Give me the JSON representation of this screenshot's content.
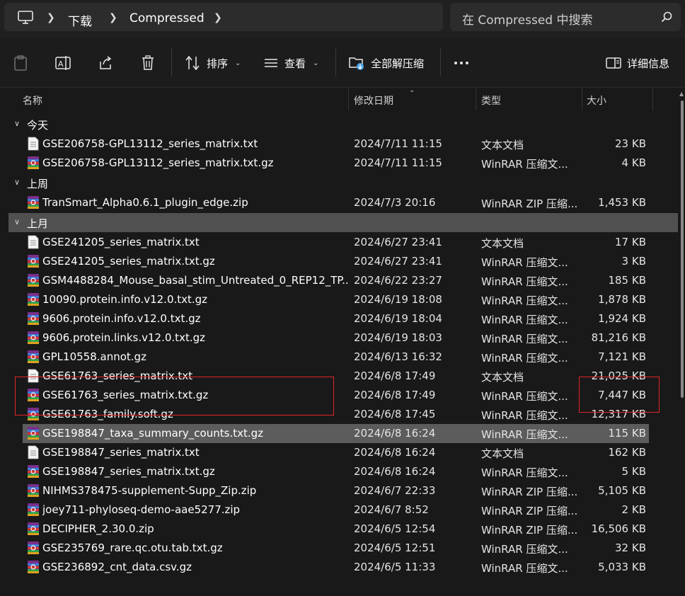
{
  "address_bar": {
    "breadcrumbs": [
      "下载",
      "Compressed"
    ],
    "search_placeholder": "在 Compressed 中搜索"
  },
  "toolbar": {
    "sort_label": "排序",
    "view_label": "查看",
    "extract_label": "全部解压缩",
    "details_label": "详细信息"
  },
  "columns": {
    "name": "名称",
    "date": "修改日期",
    "type": "类型",
    "size": "大小"
  },
  "groups": [
    {
      "label": "今天",
      "files": [
        {
          "name": "GSE206758-GPL13112_series_matrix.txt",
          "date": "2024/7/11 11:15",
          "type": "文本文档",
          "size": "23 KB",
          "icon": "text-file-icon"
        },
        {
          "name": "GSE206758-GPL13112_series_matrix.txt.gz",
          "date": "2024/7/11 11:15",
          "type": "WinRAR 压缩文...",
          "size": "4 KB",
          "icon": "winrar-archive-icon"
        }
      ]
    },
    {
      "label": "上周",
      "files": [
        {
          "name": "TranSmart_Alpha0.6.1_plugin_edge.zip",
          "date": "2024/7/3 20:16",
          "type": "WinRAR ZIP 压缩...",
          "size": "1,453 KB",
          "icon": "winrar-archive-icon"
        }
      ]
    },
    {
      "label": "上月",
      "files": [
        {
          "name": "GSE241205_series_matrix.txt",
          "date": "2024/6/27 23:41",
          "type": "文本文档",
          "size": "17 KB",
          "icon": "text-file-icon"
        },
        {
          "name": "GSE241205_series_matrix.txt.gz",
          "date": "2024/6/27 23:41",
          "type": "WinRAR 压缩文...",
          "size": "3 KB",
          "icon": "winrar-archive-icon"
        },
        {
          "name": "GSM4488284_Mouse_basal_stim_Untreated_0_REP12_TP...",
          "date": "2024/6/22 23:27",
          "type": "WinRAR 压缩文...",
          "size": "185 KB",
          "icon": "winrar-archive-icon"
        },
        {
          "name": "10090.protein.info.v12.0.txt.gz",
          "date": "2024/6/19 18:08",
          "type": "WinRAR 压缩文...",
          "size": "1,878 KB",
          "icon": "winrar-archive-icon"
        },
        {
          "name": "9606.protein.info.v12.0.txt.gz",
          "date": "2024/6/19 18:04",
          "type": "WinRAR 压缩文...",
          "size": "1,924 KB",
          "icon": "winrar-archive-icon"
        },
        {
          "name": "9606.protein.links.v12.0.txt.gz",
          "date": "2024/6/19 18:03",
          "type": "WinRAR 压缩文...",
          "size": "81,216 KB",
          "icon": "winrar-archive-icon"
        },
        {
          "name": "GPL10558.annot.gz",
          "date": "2024/6/13 16:32",
          "type": "WinRAR 压缩文...",
          "size": "7,121 KB",
          "icon": "winrar-archive-icon"
        },
        {
          "name": "GSE61763_series_matrix.txt",
          "date": "2024/6/8 17:49",
          "type": "文本文档",
          "size": "21,025 KB",
          "icon": "text-file-icon"
        },
        {
          "name": "GSE61763_series_matrix.txt.gz",
          "date": "2024/6/8 17:49",
          "type": "WinRAR 压缩文...",
          "size": "7,447 KB",
          "icon": "winrar-archive-icon"
        },
        {
          "name": "GSE61763_family.soft.gz",
          "date": "2024/6/8 17:45",
          "type": "WinRAR 压缩文...",
          "size": "12,317 KB",
          "icon": "winrar-archive-icon"
        },
        {
          "name": "GSE198847_taxa_summary_counts.txt.gz",
          "date": "2024/6/8 16:24",
          "type": "WinRAR 压缩文...",
          "size": "115 KB",
          "icon": "winrar-archive-icon"
        },
        {
          "name": "GSE198847_series_matrix.txt",
          "date": "2024/6/8 16:24",
          "type": "文本文档",
          "size": "162 KB",
          "icon": "text-file-icon"
        },
        {
          "name": "GSE198847_series_matrix.txt.gz",
          "date": "2024/6/8 16:24",
          "type": "WinRAR 压缩文...",
          "size": "5 KB",
          "icon": "winrar-archive-icon"
        },
        {
          "name": "NIHMS378475-supplement-Supp_Zip.zip",
          "date": "2024/6/7 22:33",
          "type": "WinRAR ZIP 压缩...",
          "size": "5,105 KB",
          "icon": "winrar-archive-icon"
        },
        {
          "name": "joey711-phyloseq-demo-aae5277.zip",
          "date": "2024/6/7 8:52",
          "type": "WinRAR ZIP 压缩...",
          "size": "2 KB",
          "icon": "winrar-archive-icon"
        },
        {
          "name": "DECIPHER_2.30.0.zip",
          "date": "2024/6/5 12:54",
          "type": "WinRAR ZIP 压缩...",
          "size": "16,506 KB",
          "icon": "winrar-archive-icon"
        },
        {
          "name": "GSE235769_rare.qc.otu.tab.txt.gz",
          "date": "2024/6/5 12:51",
          "type": "WinRAR 压缩文...",
          "size": "32 KB",
          "icon": "winrar-archive-icon"
        },
        {
          "name": "GSE236892_cnt_data.csv.gz",
          "date": "2024/6/5 11:33",
          "type": "WinRAR 压缩文...",
          "size": "5,033 KB",
          "icon": "winrar-archive-icon"
        }
      ]
    }
  ],
  "selected_group": "上月",
  "selected_file": "GSE198847_taxa_summary_counts.txt.gz",
  "highlight_color": "#e0262b"
}
